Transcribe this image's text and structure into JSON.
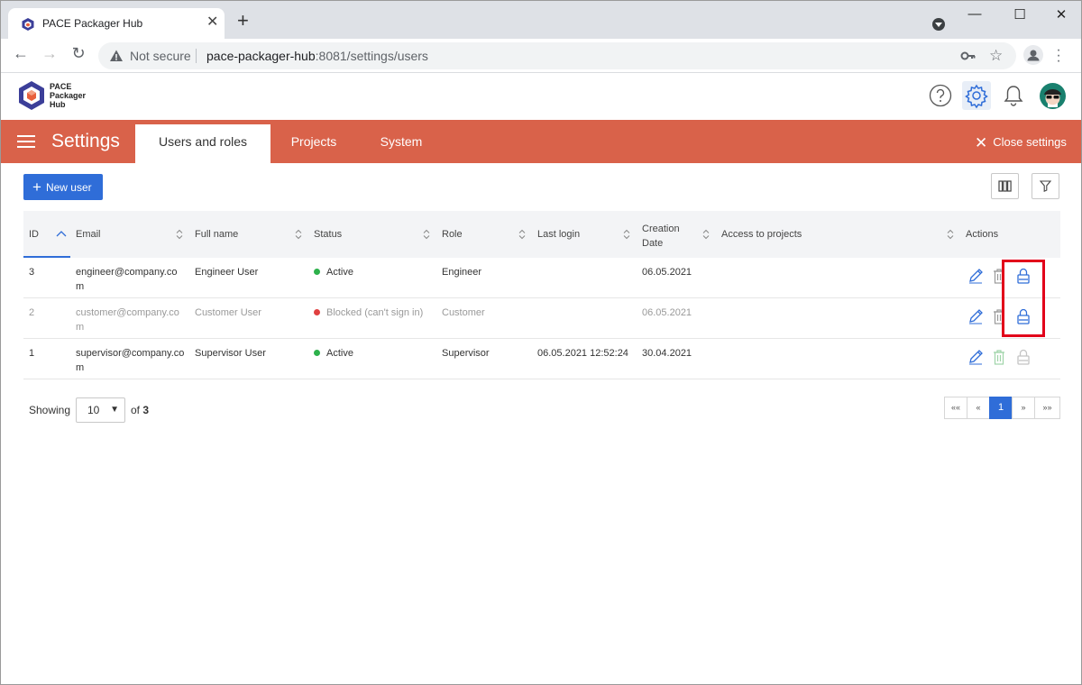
{
  "browser": {
    "tab_title": "PACE Packager Hub",
    "tab_close": "✕",
    "new_tab": "+",
    "security_label": "Not secure",
    "url_host": "pace-packager-hub",
    "url_rest": ":8081/settings/users",
    "window_controls": {
      "minimize": "—",
      "maximize": "☐",
      "close": "✕"
    }
  },
  "app": {
    "logo_text_1": "PACE",
    "logo_text_2": "Packager",
    "logo_text_3": "Hub",
    "brand_colors": {
      "primary": "#2f6dd8",
      "settings_bar": "#d9624a",
      "logo": "#3c3f99",
      "logo_accent": "#e8603c"
    }
  },
  "settings": {
    "title": "Settings",
    "tabs": [
      {
        "label": "Users and roles",
        "active": true
      },
      {
        "label": "Projects",
        "active": false
      },
      {
        "label": "System",
        "active": false
      }
    ],
    "close_label": "Close settings"
  },
  "toolbar": {
    "new_user_label": "New user"
  },
  "table": {
    "headers": {
      "id": "ID",
      "email": "Email",
      "full_name": "Full name",
      "status": "Status",
      "role": "Role",
      "last_login": "Last login",
      "creation_date_1": "Creation",
      "creation_date_2": "Date",
      "access": "Access to projects",
      "actions": "Actions"
    },
    "rows": [
      {
        "id": "3",
        "email_1": "engineer@company.co",
        "email_2": "m",
        "full_name": "Engineer User",
        "status": "Active",
        "status_color": "#2db14b",
        "role": "Engineer",
        "last_login": "",
        "creation_date": "06.05.2021"
      },
      {
        "id": "2",
        "email_1": "customer@company.co",
        "email_2": "m",
        "full_name": "Customer User",
        "status": "Blocked (can't sign in)",
        "status_color": "#e04040",
        "role": "Customer",
        "last_login": "",
        "creation_date": "06.05.2021"
      },
      {
        "id": "1",
        "email_1": "supervisor@company.co",
        "email_2": "m",
        "full_name": "Supervisor User",
        "status": "Active",
        "status_color": "#2db14b",
        "role": "Supervisor",
        "last_login": "06.05.2021 12:52:24",
        "creation_date": "30.04.2021"
      }
    ]
  },
  "pagination": {
    "showing_label": "Showing",
    "page_size": "10",
    "of_label": "of",
    "total": "3",
    "first": "««",
    "prev": "«",
    "current": "1",
    "next": "»",
    "last": "»»"
  }
}
